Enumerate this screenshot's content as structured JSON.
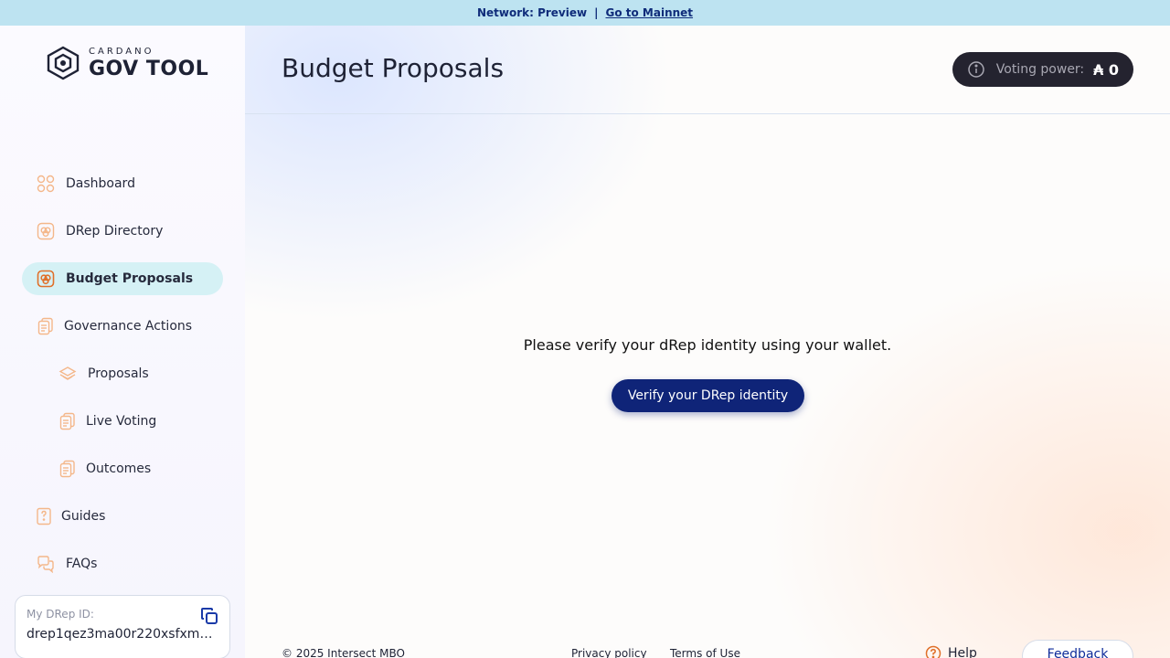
{
  "banner": {
    "network": "Network: Preview",
    "separator": "|",
    "link": "Go to Mainnet"
  },
  "logo": {
    "small": "CARDANO",
    "big": "GOV TOOL"
  },
  "nav": {
    "dashboard": "Dashboard",
    "drep_directory": "DRep Directory",
    "budget_proposals": "Budget Proposals",
    "governance_actions": "Governance Actions",
    "proposals": "Proposals",
    "live_voting": "Live Voting",
    "outcomes": "Outcomes",
    "guides": "Guides",
    "faqs": "FAQs"
  },
  "drep": {
    "label": "My DRep ID:",
    "value": "drep1qez3ma00r220xsfxmk..."
  },
  "header": {
    "title": "Budget Proposals",
    "voting_power_label": "Voting power:",
    "voting_power_value": "₳ 0"
  },
  "main": {
    "message": "Please verify your dRep identity using your wallet.",
    "button": "Verify your DRep identity"
  },
  "footer": {
    "copyright": "© 2025 Intersect MBO",
    "privacy": "Privacy policy",
    "terms": "Terms of Use",
    "help": "Help",
    "feedback": "Feedback"
  },
  "colors": {
    "accent_navy": "#0f2478",
    "active_nav_bg": "#d5f1f5",
    "icon_orange": "#f4a76a",
    "banner_bg": "#bde3f1"
  }
}
